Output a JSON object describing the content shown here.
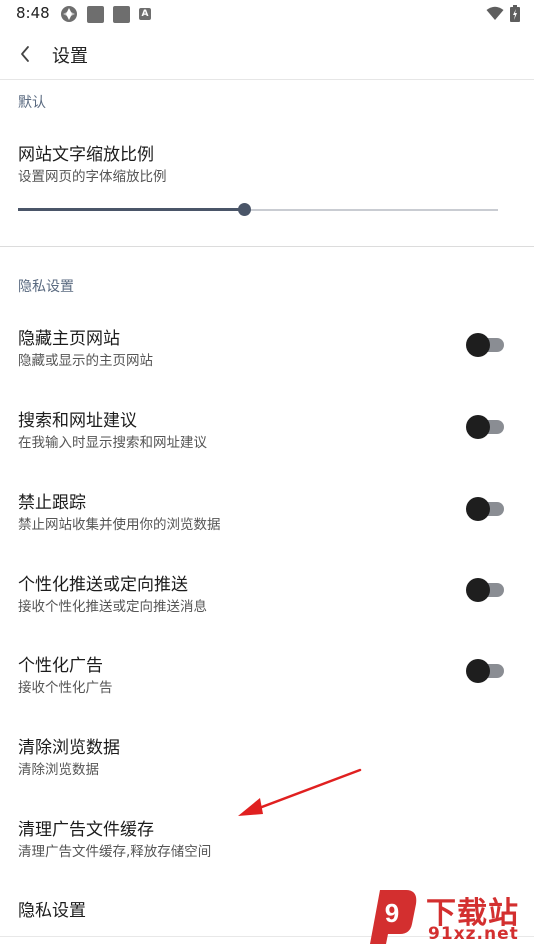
{
  "status_bar": {
    "time": "8:48",
    "left_icons": [
      "app-icon",
      "notification-icon",
      "notification-icon",
      "a-badge-icon"
    ],
    "a_badge": "A",
    "right_icons": [
      "wifi-icon",
      "battery-icon"
    ]
  },
  "app_bar": {
    "title": "设置",
    "back_icon": "chevron-left-icon"
  },
  "sections": {
    "default": {
      "header": "默认"
    },
    "privacy": {
      "header": "隐私设置"
    }
  },
  "font_scale": {
    "title": "网站文字缩放比例",
    "subtitle": "设置网页的字体缩放比例",
    "slider_value": 0.47
  },
  "items": [
    {
      "title": "隐藏主页网站",
      "subtitle": "隐藏或显示的主页网站",
      "toggle": false
    },
    {
      "title": "搜索和网址建议",
      "subtitle": "在我输入时显示搜索和网址建议",
      "toggle": false
    },
    {
      "title": "禁止跟踪",
      "subtitle": "禁止网站收集并使用你的浏览数据",
      "toggle": false
    },
    {
      "title": "个性化推送或定向推送",
      "subtitle": "接收个性化推送或定向推送消息",
      "toggle": false
    },
    {
      "title": "个性化广告",
      "subtitle": "接收个性化广告",
      "toggle": false
    },
    {
      "title": "清除浏览数据",
      "subtitle": "清除浏览数据"
    },
    {
      "title": "清理广告文件缓存",
      "subtitle": "清理广告文件缓存,释放存储空间"
    },
    {
      "title": "隐私设置"
    }
  ],
  "watermark": {
    "brand": "下载站",
    "url": "91xz.net",
    "logo_text": "9"
  },
  "colors": {
    "accent": "#4a5568",
    "toggle_track": "#8a8d93",
    "toggle_thumb": "#1e1e1e",
    "annotation_arrow": "#e02020",
    "watermark": "#d32f2f"
  }
}
